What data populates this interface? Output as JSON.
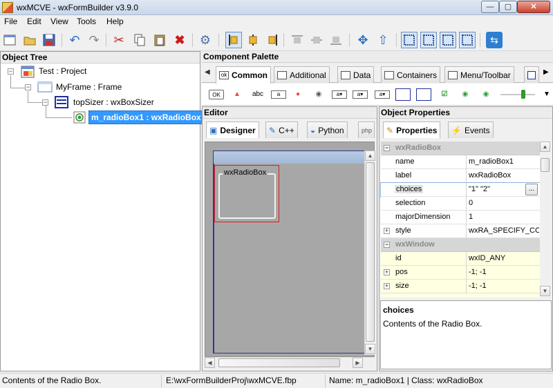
{
  "window": {
    "title": "wxMCVE - wxFormBuilder v3.9.0",
    "min_glyph": "—",
    "max_glyph": "▢",
    "close_glyph": "✕"
  },
  "menu": [
    "File",
    "Edit",
    "View",
    "Tools",
    "Help"
  ],
  "toolbar": {
    "icons": [
      "new-project-icon",
      "open-project-icon",
      "save-project-icon",
      "undo-icon",
      "redo-icon",
      "cut-icon",
      "copy-icon",
      "paste-icon",
      "delete-icon",
      "generate-code-icon",
      "align-left-icon",
      "align-center-h-icon",
      "align-right-icon",
      "align-top-icon",
      "align-center-v-icon",
      "align-bottom-icon",
      "expand-icon",
      "stretch-icon",
      "border-left-icon",
      "border-right-icon",
      "border-top-icon",
      "border-bottom-icon",
      "toggle-orientation-icon"
    ]
  },
  "object_tree": {
    "header": "Object Tree",
    "nodes": [
      {
        "label": "Test : Project"
      },
      {
        "label": "MyFrame : Frame"
      },
      {
        "label": "topSizer : wxBoxSizer"
      },
      {
        "label": "m_radioBox1 : wxRadioBox"
      }
    ]
  },
  "palette": {
    "header": "Component Palette",
    "tabs": [
      "Common",
      "Additional",
      "Data",
      "Containers",
      "Menu/Toolbar"
    ],
    "active_tab": "Common",
    "icon_labels": [
      "OK",
      "abc"
    ]
  },
  "editor": {
    "header": "Editor",
    "tabs": [
      "Designer",
      "C++",
      "Python"
    ],
    "active_tab": "Designer",
    "radiobox_label": "wxRadioBox"
  },
  "properties": {
    "header": "Object Properties",
    "tabs": [
      "Properties",
      "Events"
    ],
    "rows": [
      {
        "kind": "category",
        "name": "wxRadioBox",
        "expander": "−"
      },
      {
        "kind": "prop",
        "name": "name",
        "value": "m_radioBox1"
      },
      {
        "kind": "prop",
        "name": "label",
        "value": "wxRadioBox"
      },
      {
        "kind": "prop",
        "name": "choices",
        "value": "\"1\" \"2\""
      },
      {
        "kind": "prop",
        "name": "selection",
        "value": "0"
      },
      {
        "kind": "prop",
        "name": "majorDimension",
        "value": "1"
      },
      {
        "kind": "prop",
        "name": "style",
        "value": "wxRA_SPECIFY_COLS",
        "expander": "+"
      },
      {
        "kind": "category",
        "name": "wxWindow",
        "expander": "−"
      },
      {
        "kind": "prop",
        "name": "id",
        "value": "wxID_ANY",
        "highlight": true
      },
      {
        "kind": "prop",
        "name": "pos",
        "value": "-1; -1",
        "highlight": true,
        "expander": "+"
      },
      {
        "kind": "prop",
        "name": "size",
        "value": "-1; -1",
        "highlight": true,
        "expander": "+"
      }
    ],
    "ellipsis": "...",
    "help_title": "choices",
    "help_text": "Contents of the Radio Box."
  },
  "status": {
    "message": "Contents of the Radio Box.",
    "file": "E:\\wxFormBuilderProj\\wxMCVE.fbp",
    "selection": "Name: m_radioBox1 | Class: wxRadioBox"
  },
  "colors": {
    "selection": "#3399ff",
    "highlight_row": "#ffffe1",
    "editor_canvas": "#a7a7a7",
    "selection_border": "#e21b1b"
  }
}
